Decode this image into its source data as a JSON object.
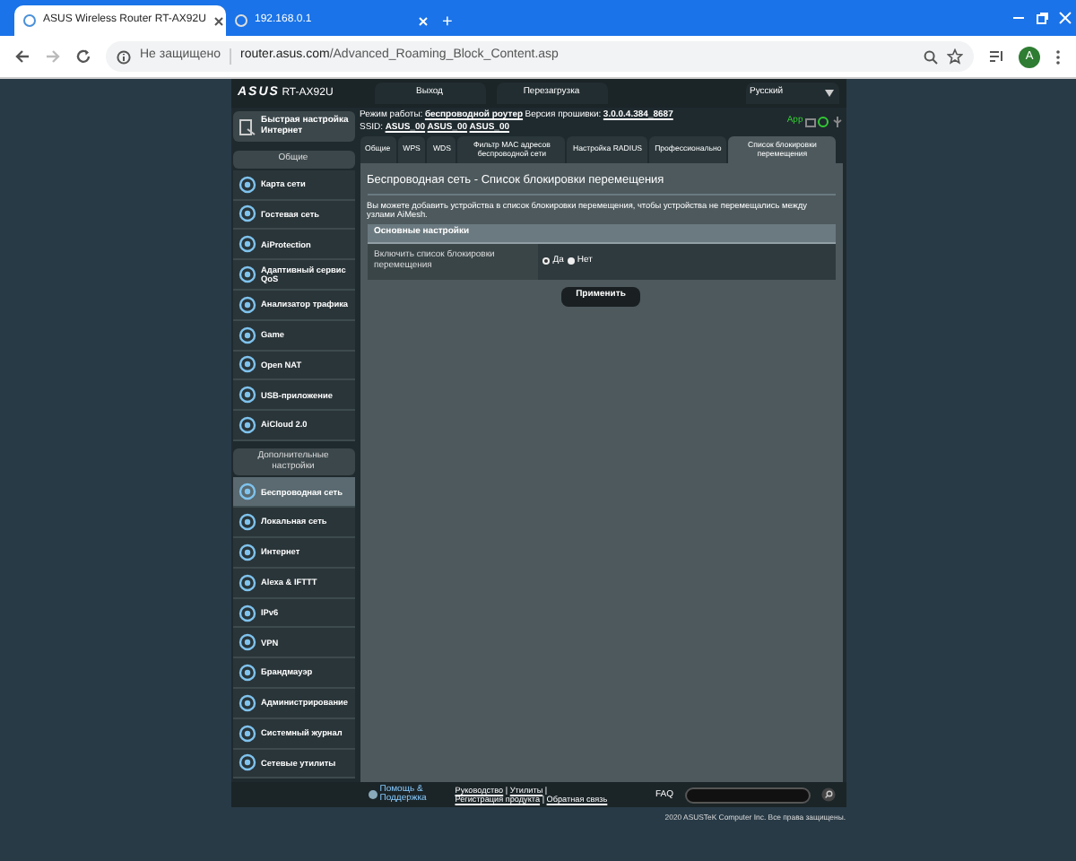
{
  "browser": {
    "tabs": [
      {
        "title": "ASUS Wireless Router RT-AX92U",
        "selected": true
      },
      {
        "title": "192.168.0.1",
        "selected": false
      }
    ],
    "new_tab": "+",
    "security": "Не защищено",
    "url_host": "router.asus.com",
    "url_path": "/Advanced_Roaming_Block_Content.asp",
    "avatar": "A"
  },
  "header": {
    "logo": "ASUS",
    "model": "RT-AX92U",
    "buttons": [
      "Выход",
      "Перезагрузка"
    ],
    "language": "Русский"
  },
  "status": {
    "mode_label": "Режим работы:",
    "mode": "беспроводной роутер",
    "fw_label": "Версия прошивки:",
    "fw": "3.0.0.4.384_8687",
    "ssid_label": "SSID:",
    "ssids": [
      "ASUS_00",
      "ASUS_00",
      "ASUS_00"
    ],
    "app": "App"
  },
  "sidebar": {
    "quick_setup": "Быстрая настройка Интернет",
    "sections": [
      {
        "title": "Общие",
        "items": [
          {
            "label": "Карта сети",
            "selected": false
          },
          {
            "label": "Гостевая сеть",
            "selected": false
          },
          {
            "label": "AiProtection",
            "selected": false
          },
          {
            "label": "Адаптивный сервис QoS",
            "selected": false
          },
          {
            "label": "Анализатор трафика",
            "selected": false
          },
          {
            "label": "Game",
            "selected": false
          },
          {
            "label": "Open NAT",
            "selected": false
          },
          {
            "label": "USB-приложение",
            "selected": false
          },
          {
            "label": "AiCloud 2.0",
            "selected": false
          }
        ]
      },
      {
        "title": "Дополнительные настройки",
        "items": [
          {
            "label": "Беспроводная сеть",
            "selected": true
          },
          {
            "label": "Локальная сеть",
            "selected": false
          },
          {
            "label": "Интернет",
            "selected": false
          },
          {
            "label": "Alexa & IFTTT",
            "selected": false
          },
          {
            "label": "IPv6",
            "selected": false
          },
          {
            "label": "VPN",
            "selected": false
          },
          {
            "label": "Брандмауэр",
            "selected": false
          },
          {
            "label": "Администрирование",
            "selected": false
          },
          {
            "label": "Системный журнал",
            "selected": false
          },
          {
            "label": "Сетевые утилиты",
            "selected": false
          }
        ]
      }
    ]
  },
  "tabs": [
    {
      "label": "Общие",
      "selected": false
    },
    {
      "label": "WPS",
      "selected": false
    },
    {
      "label": "WDS",
      "selected": false
    },
    {
      "label": "Фильтр MAC адресов беспроводной сети",
      "selected": false
    },
    {
      "label": "Настройка RADIUS",
      "selected": false
    },
    {
      "label": "Профессионально",
      "selected": false
    },
    {
      "label": "Список блокировки перемещения",
      "selected": true
    }
  ],
  "content": {
    "title": "Беспроводная сеть - Список блокировки перемещения",
    "description": "Вы можете добавить устройства в список блокировки перемещения, чтобы устройства не перемещались между узлами AiMesh.",
    "section": "Основные настройки",
    "setting_label": "Включить список блокировки перемещения",
    "options": [
      {
        "label": "Да",
        "selected": true
      },
      {
        "label": "Нет",
        "selected": false
      }
    ],
    "apply": "Применить"
  },
  "footer": {
    "help": "Помощь & Поддержка",
    "links": [
      "Руководство",
      "Утилиты",
      "Регистрация продукта",
      "Обратная связь"
    ],
    "separators": [
      "|",
      "|",
      "|"
    ],
    "faq": "FAQ",
    "copyright": "2020 ASUSTeK Computer Inc. Все права защищены."
  }
}
